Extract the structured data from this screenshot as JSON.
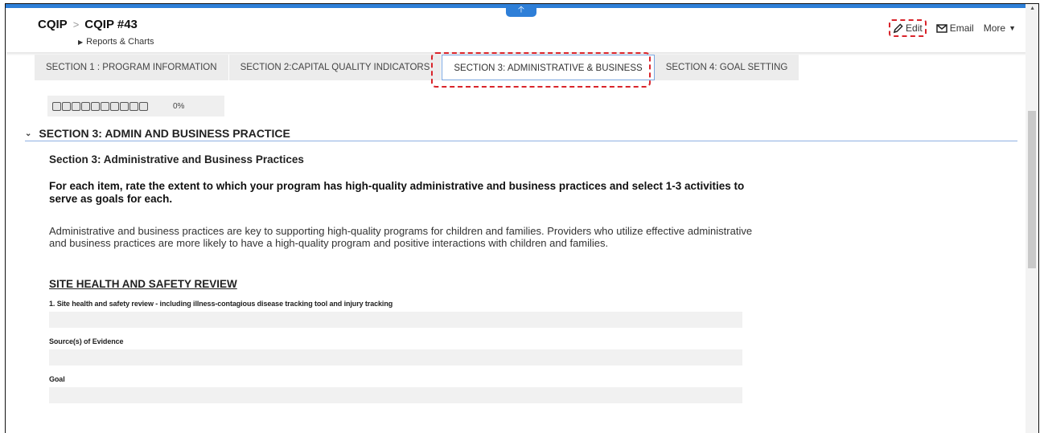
{
  "breadcrumb": {
    "root": "CQIP",
    "separator": ">",
    "current": "CQIP #43",
    "sub": "Reports & Charts"
  },
  "actions": {
    "edit": "Edit",
    "email": "Email",
    "more": "More"
  },
  "tabs": [
    {
      "label": "SECTION 1 : PROGRAM INFORMATION",
      "active": false
    },
    {
      "label": "SECTION 2:CAPITAL QUALITY INDICATORS",
      "active": false
    },
    {
      "label": "SECTION 3: ADMINISTRATIVE & BUSINESS",
      "active": true
    },
    {
      "label": "SECTION 4: GOAL SETTING",
      "active": false
    }
  ],
  "progress": {
    "segments": 10,
    "value": 0,
    "label": "0%"
  },
  "section": {
    "title": "SECTION 3: ADMIN AND BUSINESS PRACTICE",
    "subtitle": "Section 3: Administrative and Business Practices",
    "intro": "For each item, rate the extent to which your program has high-quality administrative and business practices and select 1-3 activities to serve as goals for each.",
    "description": "Administrative and business practices are key to supporting high-quality programs for children and families. Providers who utilize effective administrative and business practices are more likely to have a high-quality program and positive interactions with children and families.",
    "group_title": "SITE HEALTH AND SAFETY REVIEW",
    "fields": [
      {
        "label": "1. Site health and safety review - including illness-contagious disease tracking tool and injury tracking",
        "value": ""
      },
      {
        "label": "Source(s) of Evidence",
        "value": ""
      },
      {
        "label": "Goal",
        "value": ""
      }
    ]
  },
  "colors": {
    "accent": "#2e7fd8",
    "highlight": "#d9242b"
  },
  "icons": {
    "edit": "pencil-icon",
    "email": "envelope-icon",
    "more": "caret-down-icon",
    "collapse": "arrow-up-icon",
    "section": "chevron-down-icon"
  }
}
